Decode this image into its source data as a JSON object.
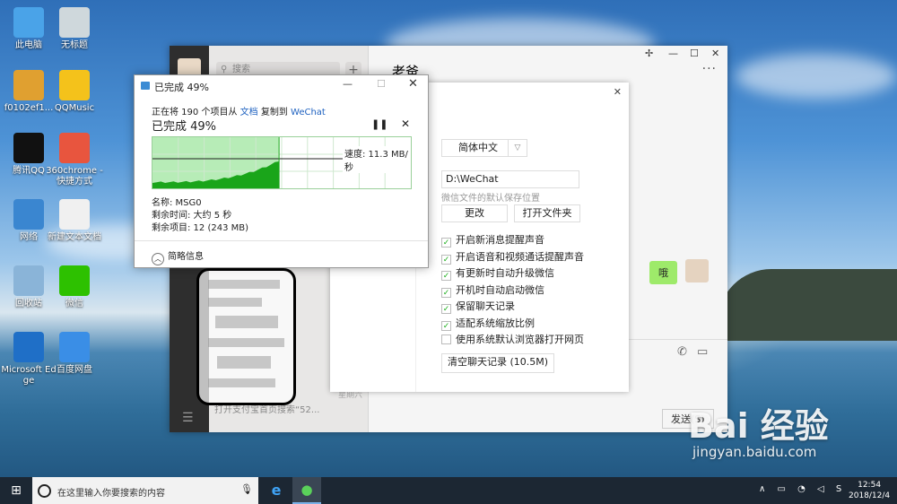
{
  "desktop_icons": [
    {
      "label": "此电脑",
      "icon": "computer-icon",
      "color": "#4aa3e8"
    },
    {
      "label": "无标题",
      "icon": "document-icon",
      "color": "#cfd8dc"
    },
    {
      "label": "f0102ef1...",
      "icon": "image-file-icon",
      "color": "#e0a030"
    },
    {
      "label": "QQMusic",
      "icon": "qqmusic-icon",
      "color": "#f4c21b"
    },
    {
      "label": "腾讯QQ",
      "icon": "qq-icon",
      "color": "#111111"
    },
    {
      "label": "360chrome - 快捷方式",
      "icon": "360chrome-icon",
      "color": "#e8553e"
    },
    {
      "label": "网络",
      "icon": "network-icon",
      "color": "#3a86d0"
    },
    {
      "label": "新建文本文档",
      "icon": "text-file-icon",
      "color": "#f0f0f0"
    },
    {
      "label": "回收站",
      "icon": "recycle-bin-icon",
      "color": "#8ab4d8"
    },
    {
      "label": "微信",
      "icon": "wechat-icon",
      "color": "#2dc100"
    },
    {
      "label": "Microsoft Edge",
      "icon": "edge-icon",
      "color": "#1f6fc7"
    },
    {
      "label": "百度网盘",
      "icon": "baidu-netdisk-icon",
      "color": "#3a8ee6"
    }
  ],
  "wechat": {
    "search_placeholder": "搜索",
    "chat_title": "老爸",
    "bubble_text": "哦",
    "list_preview": "打开支付宝首页搜索“52...",
    "list_time": "星期六",
    "send_label": "发送(S)"
  },
  "settings": {
    "language": "简体中文",
    "path": "D:\\WeChat",
    "path_hint": "微信文件的默认保存位置",
    "change_label": "更改",
    "open_folder_label": "打开文件夹",
    "options": [
      {
        "label": "开启新消息提醒声音",
        "checked": true
      },
      {
        "label": "开启语音和视频通话提醒声音",
        "checked": true
      },
      {
        "label": "有更新时自动升级微信",
        "checked": true
      },
      {
        "label": "开机时自动启动微信",
        "checked": true
      },
      {
        "label": "保留聊天记录",
        "checked": true
      },
      {
        "label": "适配系统缩放比例",
        "checked": true
      },
      {
        "label": "使用系统默认浏览器打开网页",
        "checked": false
      }
    ],
    "clear_label": "清空聊天记录 (10.5M)"
  },
  "copy_dialog": {
    "title": "已完成 49%",
    "line_prefix": "正在将 190 个项目从",
    "source": "文档",
    "line_middle": "复制到",
    "destination": "WeChat",
    "big_status": "已完成 49%",
    "progress": 0.49,
    "speed": "速度: 11.3 MB/秒",
    "name_line": "名称: MSG0",
    "time_line": "剩余时间: 大约 5 秒",
    "items_line": "剩余项目: 12 (243 MB)",
    "less_info": "简略信息",
    "graph_color": "#1aa51a"
  },
  "taskbar": {
    "search_placeholder": "在这里输入你要搜索的内容",
    "time": "12:54",
    "date": "2018/12/4"
  },
  "watermark": {
    "logo": "Bai 经验",
    "url": "jingyan.baidu.com"
  }
}
